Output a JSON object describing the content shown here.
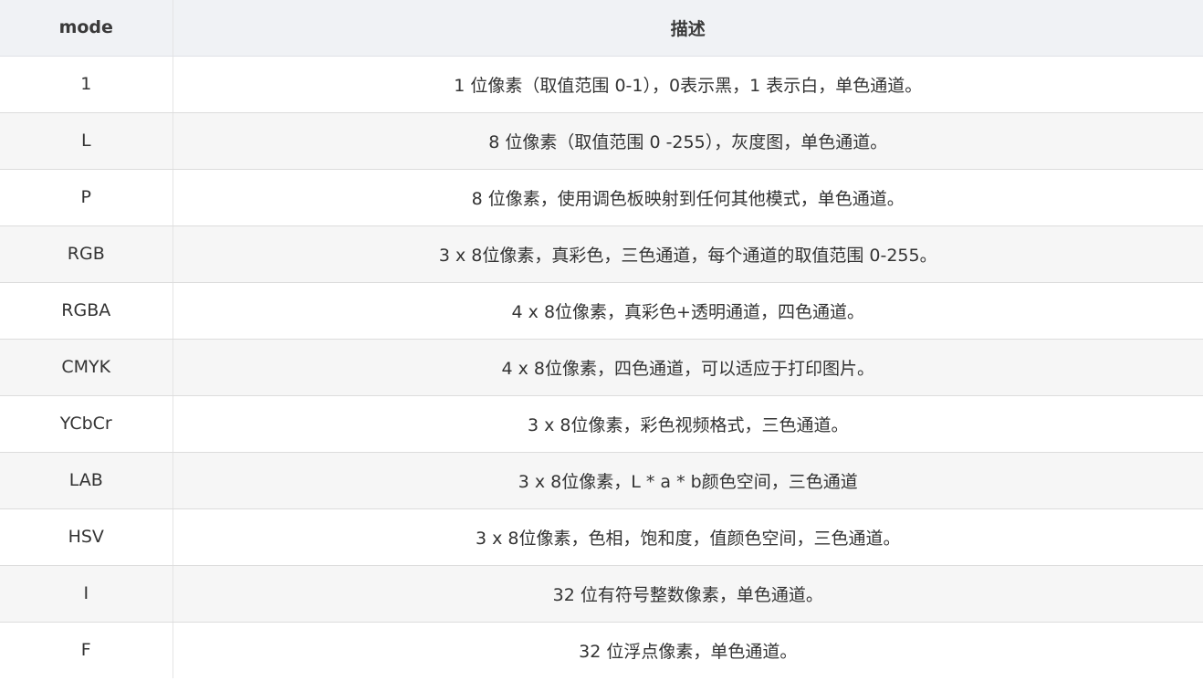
{
  "table": {
    "headers": {
      "mode": "mode",
      "description": "描述"
    },
    "rows": [
      {
        "mode": "1",
        "description": "1 位像素（取值范围 0-1），0表示黑，1 表示白，单色通道。"
      },
      {
        "mode": "L",
        "description": "8 位像素（取值范围 0 -255），灰度图，单色通道。"
      },
      {
        "mode": "P",
        "description": "8 位像素，使用调色板映射到任何其他模式，单色通道。"
      },
      {
        "mode": "RGB",
        "description": "3 x 8位像素，真彩色，三色通道，每个通道的取值范围 0-255。"
      },
      {
        "mode": "RGBA",
        "description": "4 x 8位像素，真彩色+透明通道，四色通道。"
      },
      {
        "mode": "CMYK",
        "description": "4 x 8位像素，四色通道，可以适应于打印图片。"
      },
      {
        "mode": "YCbCr",
        "description": "3 x 8位像素，彩色视频格式，三色通道。"
      },
      {
        "mode": "LAB",
        "description": "3 x 8位像素，L * a * b颜色空间，三色通道"
      },
      {
        "mode": "HSV",
        "description": "3 x 8位像素，色相，饱和度，值颜色空间，三色通道。"
      },
      {
        "mode": "I",
        "description": "32 位有符号整数像素，单色通道。"
      },
      {
        "mode": "F",
        "description": "32 位浮点像素，单色通道。"
      }
    ]
  }
}
